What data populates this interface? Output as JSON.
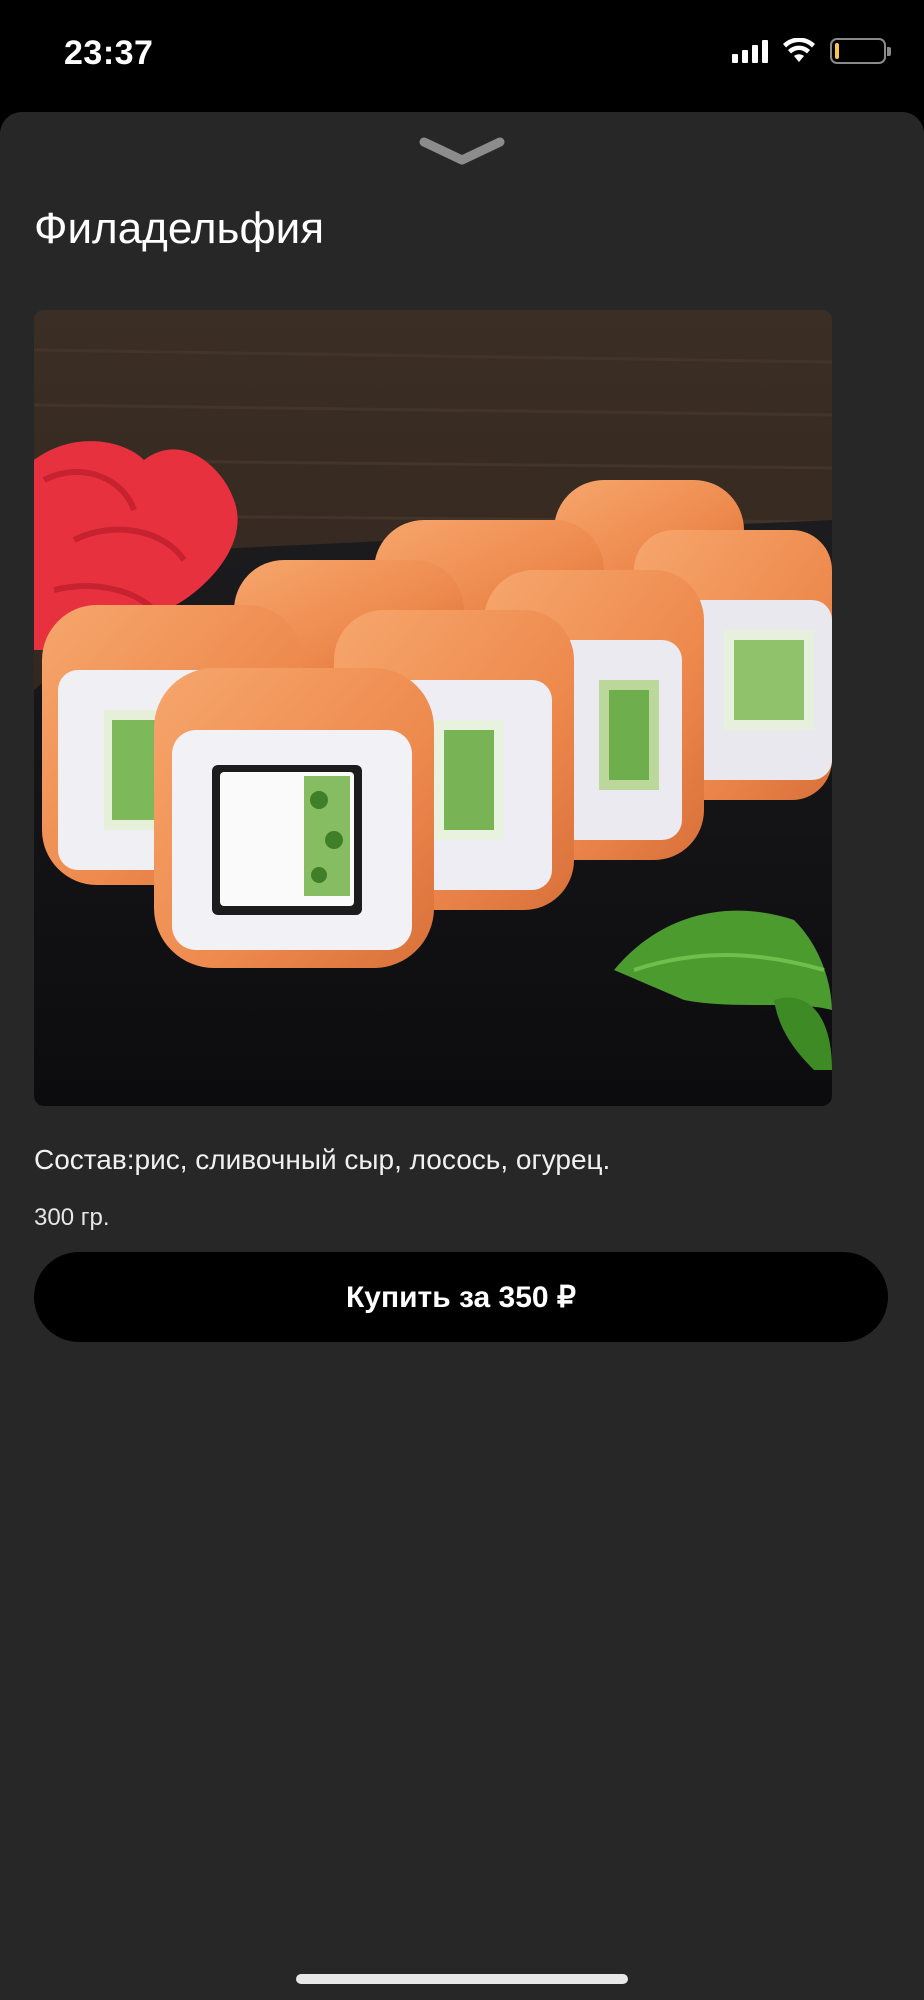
{
  "status_bar": {
    "time": "23:37",
    "icons": [
      "cellular-signal-icon",
      "wifi-icon",
      "battery-icon"
    ]
  },
  "sheet": {
    "dismiss_icon": "chevron-down-icon"
  },
  "product": {
    "title": "Филадельфия",
    "image_alt": "Ролл Филадельфия",
    "composition": "Состав:рис, сливочный сыр, лосось, огурец.",
    "weight": "300 гр.",
    "buy_label": "Купить за 350 ₽"
  },
  "colors": {
    "background": "#272727",
    "button": "#000000",
    "text": "#ffffff"
  }
}
